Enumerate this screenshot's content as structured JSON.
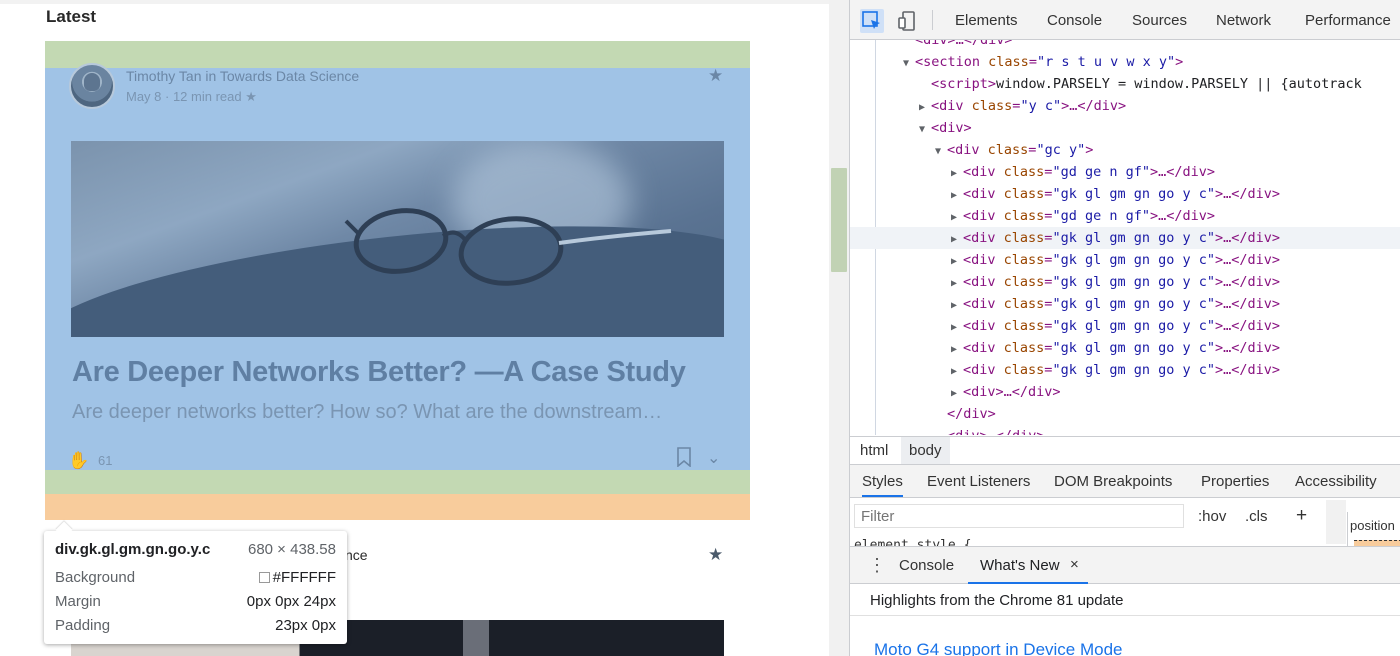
{
  "page": {
    "heading": "Latest",
    "card": {
      "author": "Timothy Tan in Towards Data Science",
      "meta": "May 8 · 12 min read ★",
      "title": "Are Deeper Networks Better? —A Case Study",
      "subtitle": "Are deeper networks better? How so? What are the downstream…",
      "claps": "61",
      "star_icon": "star-icon",
      "bookmark_icon": "bookmark-icon",
      "more_icon": "chevron-down-icon"
    },
    "card2": {
      "author_tail": "nce"
    }
  },
  "tooltip": {
    "selector": "div.gk.gl.gm.gn.go.y.c",
    "dimensions": "680 × 438.58",
    "rows": [
      {
        "label": "Background",
        "value": "#FFFFFF"
      },
      {
        "label": "Margin",
        "value": "0px 0px 24px"
      },
      {
        "label": "Padding",
        "value": "23px 0px"
      }
    ]
  },
  "devtools": {
    "tabs": [
      "Elements",
      "Console",
      "Sources",
      "Network",
      "Performance"
    ],
    "dom": [
      {
        "indent": 0,
        "tri": "",
        "html": "<div>…</div>"
      },
      {
        "indent": 0,
        "tri": "▼",
        "tag": "section",
        "attrs": "class=\"r s t u v w x y\"",
        "close": ">"
      },
      {
        "indent": 1,
        "tri": "",
        "script": "<script>window.PARSELY = window.PARSELY || {autotrack"
      },
      {
        "indent": 1,
        "tri": "▶",
        "tag": "div",
        "attrs": "class=\"y c\"",
        "close": ">…</div>"
      },
      {
        "indent": 1,
        "tri": "▼",
        "tag": "div",
        "attrs": "",
        "close": ">"
      },
      {
        "indent": 2,
        "tri": "▼",
        "tag": "div",
        "attrs": "class=\"gc y\"",
        "close": ">"
      },
      {
        "indent": 3,
        "tri": "▶",
        "tag": "div",
        "attrs": "class=\"gd ge n gf\"",
        "close": ">…</div>"
      },
      {
        "indent": 3,
        "tri": "▶",
        "tag": "div",
        "attrs": "class=\"gk gl gm gn go y c\"",
        "close": ">…</div>"
      },
      {
        "indent": 3,
        "tri": "▶",
        "tag": "div",
        "attrs": "class=\"gd ge n gf\"",
        "close": ">…</div>"
      },
      {
        "indent": 3,
        "tri": "▶",
        "tag": "div",
        "attrs": "class=\"gk gl gm gn go y c\"",
        "close": ">…</div>",
        "selected": true
      },
      {
        "indent": 3,
        "tri": "▶",
        "tag": "div",
        "attrs": "class=\"gk gl gm gn go y c\"",
        "close": ">…</div>"
      },
      {
        "indent": 3,
        "tri": "▶",
        "tag": "div",
        "attrs": "class=\"gk gl gm gn go y c\"",
        "close": ">…</div>"
      },
      {
        "indent": 3,
        "tri": "▶",
        "tag": "div",
        "attrs": "class=\"gk gl gm gn go y c\"",
        "close": ">…</div>"
      },
      {
        "indent": 3,
        "tri": "▶",
        "tag": "div",
        "attrs": "class=\"gk gl gm gn go y c\"",
        "close": ">…</div>"
      },
      {
        "indent": 3,
        "tri": "▶",
        "tag": "div",
        "attrs": "class=\"gk gl gm gn go y c\"",
        "close": ">…</div>"
      },
      {
        "indent": 3,
        "tri": "▶",
        "tag": "div",
        "attrs": "class=\"gk gl gm gn go y c\"",
        "close": ">…</div>"
      },
      {
        "indent": 3,
        "tri": "▶",
        "tag": "div",
        "attrs": "",
        "close": ">…</div>"
      },
      {
        "indent": 2,
        "tri": "",
        "html": "</div>"
      },
      {
        "indent": 2,
        "tri": "",
        "html": "<div>…</div>"
      }
    ],
    "breadcrumbs": [
      "html",
      "body"
    ],
    "styles_tabs": [
      "Styles",
      "Event Listeners",
      "DOM Breakpoints",
      "Properties",
      "Accessibility"
    ],
    "filter_placeholder": "Filter",
    "hov": ":hov",
    "cls": ".cls",
    "plus": "+",
    "position_label": "position",
    "element_style": "element.style {",
    "drawer_tabs": [
      "Console",
      "What's New"
    ],
    "drawer_close": "×",
    "whatsnew_heading": "Highlights from the Chrome 81 update",
    "whatsnew_link": "Moto G4 support in Device Mode"
  },
  "colors": {
    "overlay_content": "#a0c3e6",
    "overlay_margin": "#c3d9b3",
    "overlay_padding": "#f8cc9c",
    "accent": "#1a73e8"
  }
}
